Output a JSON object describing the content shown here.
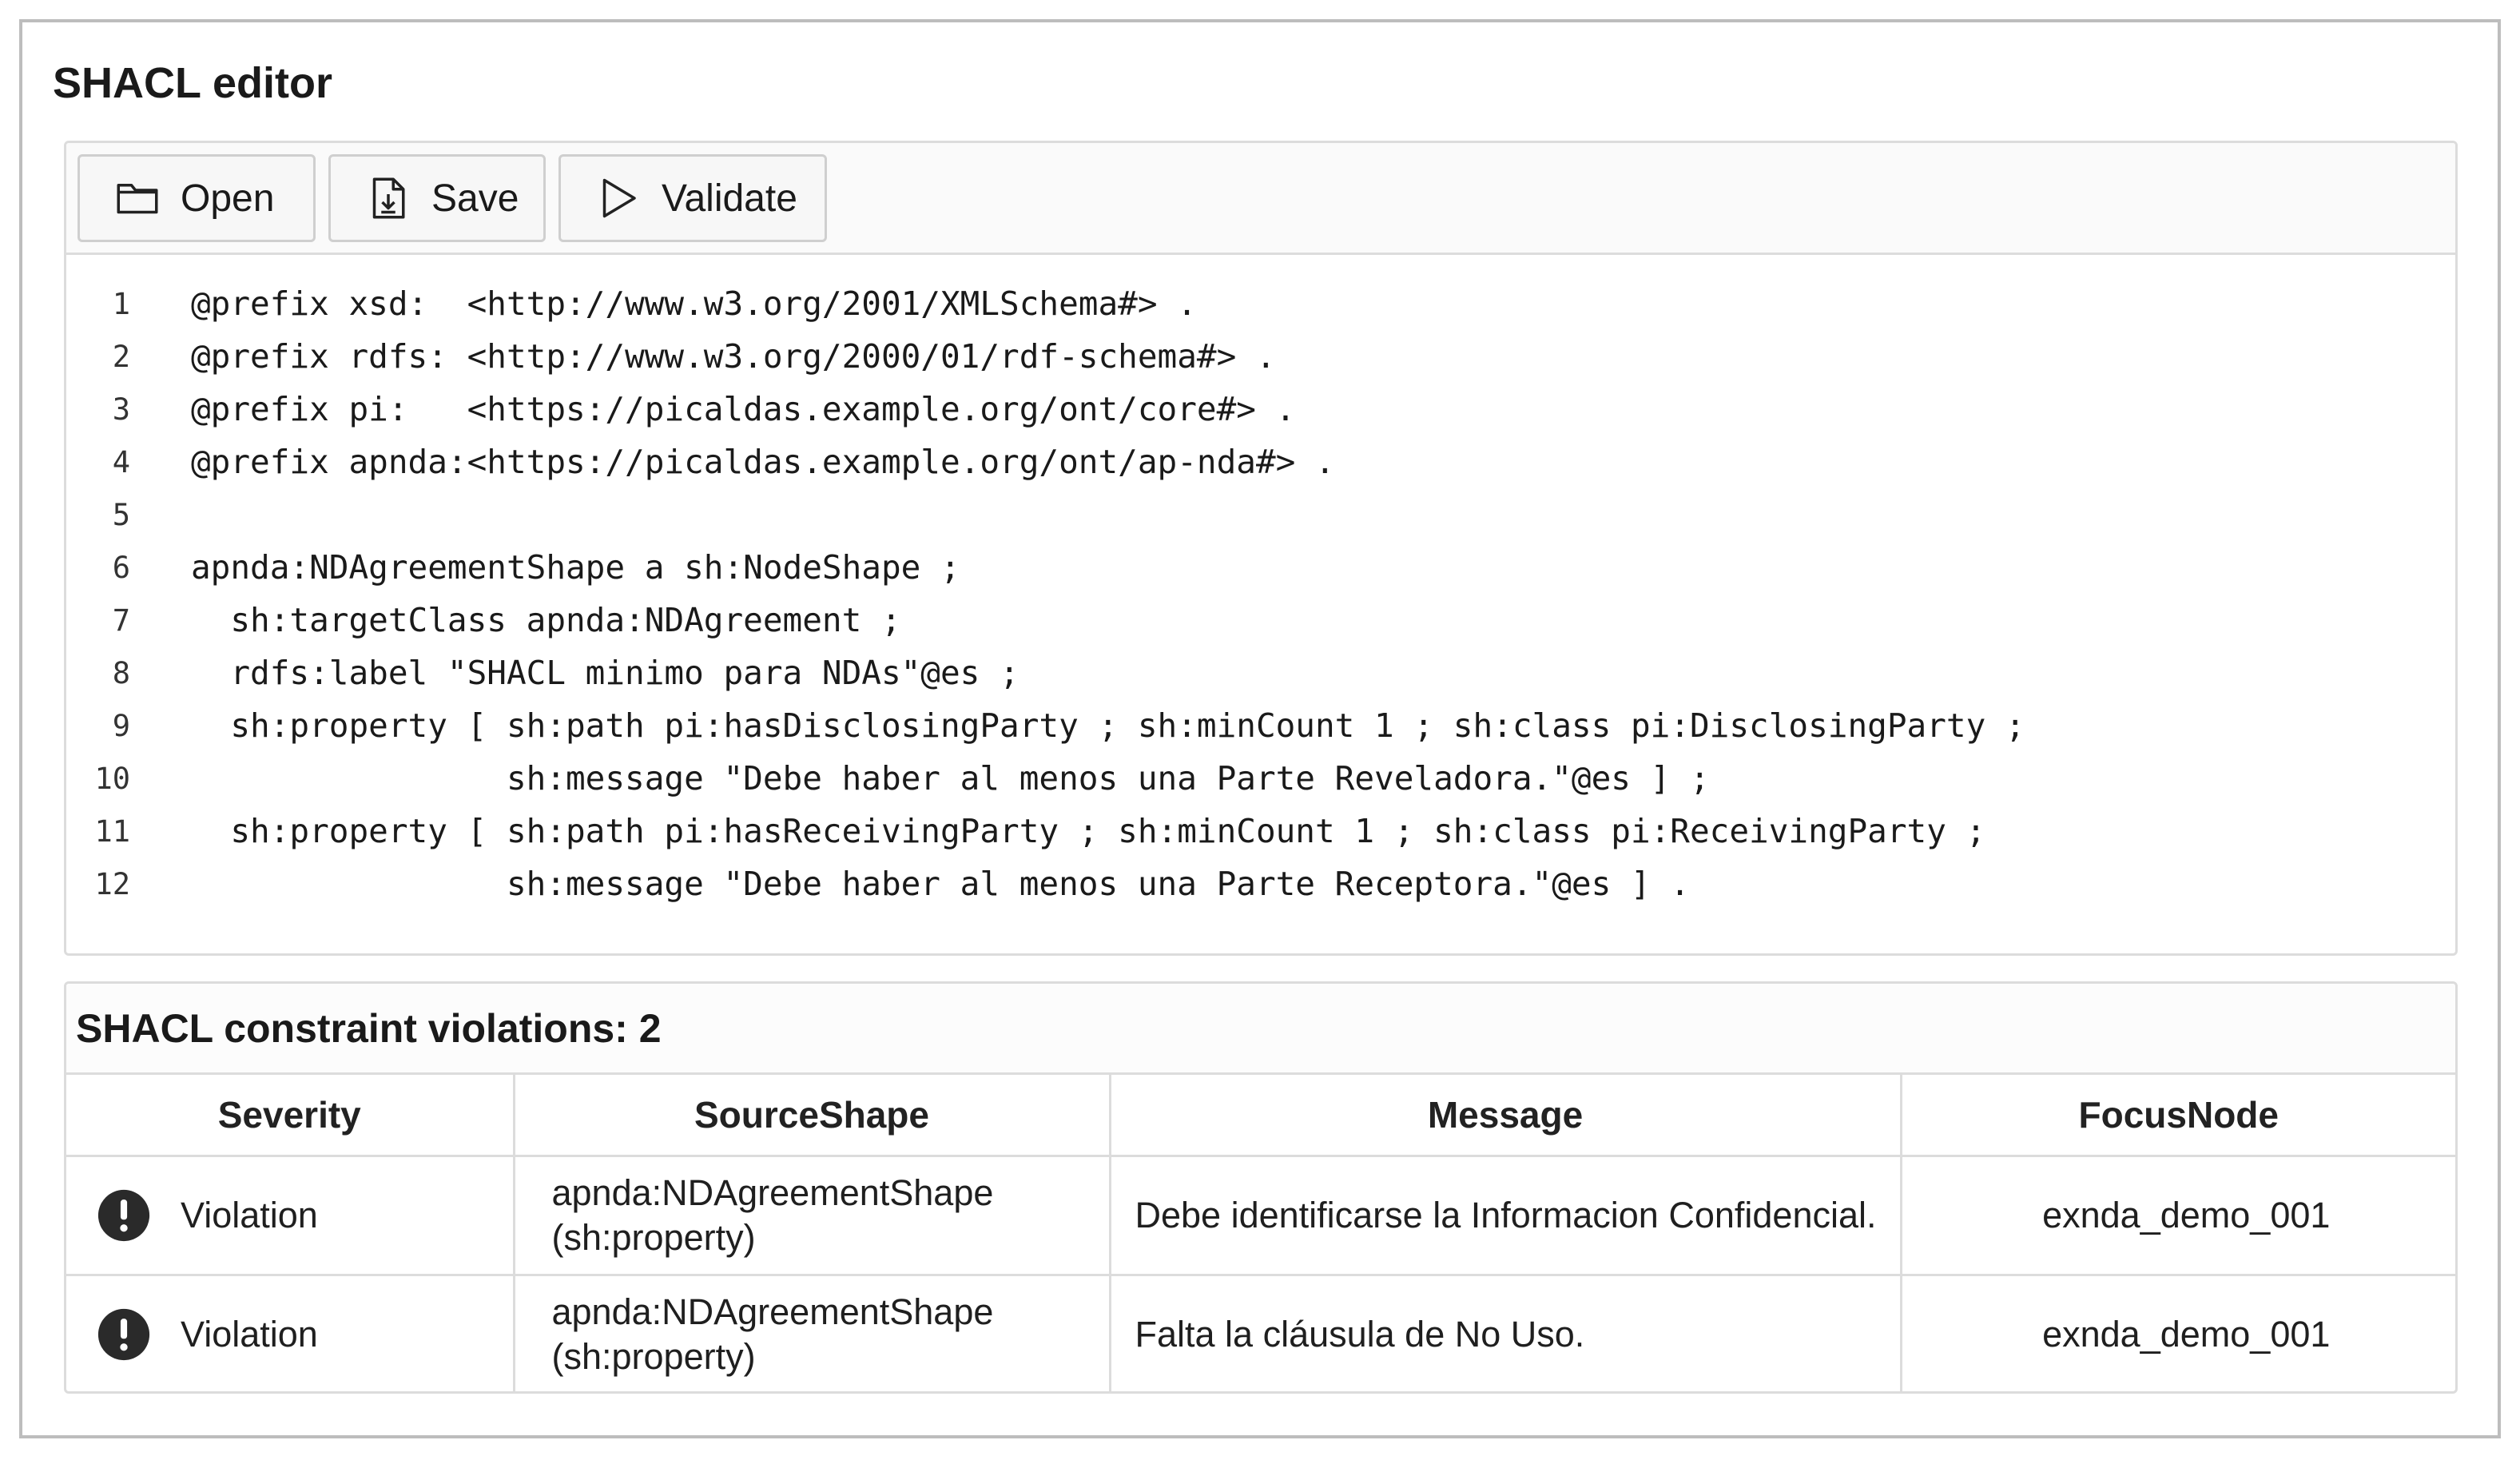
{
  "editor": {
    "title": "SHACL editor",
    "toolbar": {
      "open_label": "Open",
      "open_icon": "folder-icon",
      "save_label": "Save",
      "save_icon": "save-file-icon",
      "validate_label": "Validate",
      "validate_icon": "play-icon"
    },
    "code_lines": [
      {
        "n": "1",
        "text": "@prefix xsd:  <http://www.w3.org/2001/XMLSchema#> ."
      },
      {
        "n": "2",
        "text": "@prefix rdfs: <http://www.w3.org/2000/01/rdf-schema#> ."
      },
      {
        "n": "3",
        "text": "@prefix pi:   <https://picaldas.example.org/ont/core#> ."
      },
      {
        "n": "4",
        "text": "@prefix apnda:<https://picaldas.example.org/ont/ap-nda#> ."
      },
      {
        "n": "5",
        "text": ""
      },
      {
        "n": "6",
        "text": "apnda:NDAgreementShape a sh:NodeShape ;"
      },
      {
        "n": "7",
        "text": "  sh:targetClass apnda:NDAgreement ;"
      },
      {
        "n": "8",
        "text": "  rdfs:label \"SHACL minimo para NDAs\"@es ;"
      },
      {
        "n": "9",
        "text": "  sh:property [ sh:path pi:hasDisclosingParty ; sh:minCount 1 ; sh:class pi:DisclosingParty ;"
      },
      {
        "n": "10",
        "text": "                sh:message \"Debe haber al menos una Parte Reveladora.\"@es ] ;"
      },
      {
        "n": "11",
        "text": "  sh:property [ sh:path pi:hasReceivingParty ; sh:minCount 1 ; sh:class pi:ReceivingParty ;"
      },
      {
        "n": "12",
        "text": "                sh:message \"Debe haber al menos una Parte Receptora.\"@es ] ."
      }
    ]
  },
  "violations": {
    "title": "SHACL constraint violations: 2",
    "columns": [
      "Severity",
      "SourceShape",
      "Message",
      "FocusNode"
    ],
    "rows": [
      {
        "severity": "Violation",
        "severity_icon": "exclamation-circle-icon",
        "shape_line1": "apnda:NDAgreementShape",
        "shape_line2": "(sh:property)",
        "message": "Debe identificarse la Informacion Confidencial.",
        "focus": "exnda_demo_001"
      },
      {
        "severity": "Violation",
        "severity_icon": "exclamation-circle-icon",
        "shape_line1": "apnda:NDAgreementShape",
        "shape_line2": "(sh:property)",
        "message": "Falta la cláusula de No Uso.",
        "focus": "exnda_demo_001"
      }
    ]
  }
}
